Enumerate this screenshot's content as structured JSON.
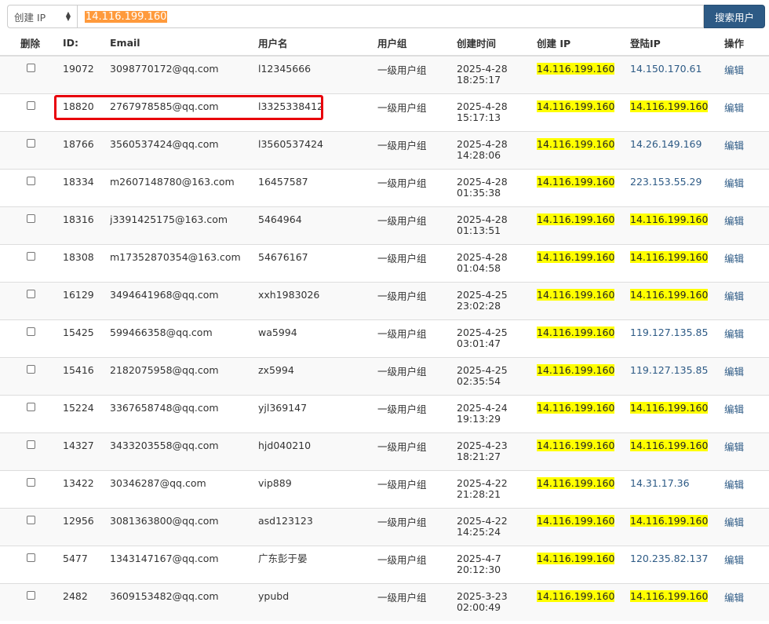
{
  "search": {
    "select_label": "创建 IP",
    "query": "14.116.199.160",
    "button_label": "搜索用户"
  },
  "table": {
    "headers": [
      "删除",
      "ID:",
      "Email",
      "用户名",
      "用户组",
      "创建时间",
      "创建 IP",
      "登陆IP",
      "操作"
    ],
    "rows": [
      {
        "id": "19072",
        "email": "3098770172@qq.com",
        "username": "l12345666",
        "group": "一级用户组",
        "date": "2025-4-28",
        "time": "18:25:17",
        "create_ip": "14.116.199.160",
        "login_ip": "14.150.170.61",
        "login_hl": false,
        "action": "编辑"
      },
      {
        "id": "18820",
        "email": "2767978585@qq.com",
        "username": "l3325338412",
        "group": "一级用户组",
        "date": "2025-4-28",
        "time": "15:17:13",
        "create_ip": "14.116.199.160",
        "login_ip": "14.116.199.160",
        "login_hl": true,
        "action": "编辑"
      },
      {
        "id": "18766",
        "email": "3560537424@qq.com",
        "username": "l3560537424",
        "group": "一级用户组",
        "date": "2025-4-28",
        "time": "14:28:06",
        "create_ip": "14.116.199.160",
        "login_ip": "14.26.149.169",
        "login_hl": false,
        "action": "编辑"
      },
      {
        "id": "18334",
        "email": "m2607148780@163.com",
        "username": "16457587",
        "group": "一级用户组",
        "date": "2025-4-28",
        "time": "01:35:38",
        "create_ip": "14.116.199.160",
        "login_ip": "223.153.55.29",
        "login_hl": false,
        "action": "编辑"
      },
      {
        "id": "18316",
        "email": "j3391425175@163.com",
        "username": "5464964",
        "group": "一级用户组",
        "date": "2025-4-28",
        "time": "01:13:51",
        "create_ip": "14.116.199.160",
        "login_ip": "14.116.199.160",
        "login_hl": true,
        "action": "编辑"
      },
      {
        "id": "18308",
        "email": "m17352870354@163.com",
        "username": "54676167",
        "group": "一级用户组",
        "date": "2025-4-28",
        "time": "01:04:58",
        "create_ip": "14.116.199.160",
        "login_ip": "14.116.199.160",
        "login_hl": true,
        "action": "编辑"
      },
      {
        "id": "16129",
        "email": "3494641968@qq.com",
        "username": "xxh1983026",
        "group": "一级用户组",
        "date": "2025-4-25",
        "time": "23:02:28",
        "create_ip": "14.116.199.160",
        "login_ip": "14.116.199.160",
        "login_hl": true,
        "action": "编辑"
      },
      {
        "id": "15425",
        "email": "599466358@qq.com",
        "username": "wa5994",
        "group": "一级用户组",
        "date": "2025-4-25",
        "time": "03:01:47",
        "create_ip": "14.116.199.160",
        "login_ip": "119.127.135.85",
        "login_hl": false,
        "action": "编辑"
      },
      {
        "id": "15416",
        "email": "2182075958@qq.com",
        "username": "zx5994",
        "group": "一级用户组",
        "date": "2025-4-25",
        "time": "02:35:54",
        "create_ip": "14.116.199.160",
        "login_ip": "119.127.135.85",
        "login_hl": false,
        "action": "编辑"
      },
      {
        "id": "15224",
        "email": "3367658748@qq.com",
        "username": "yjl369147",
        "group": "一级用户组",
        "date": "2025-4-24",
        "time": "19:13:29",
        "create_ip": "14.116.199.160",
        "login_ip": "14.116.199.160",
        "login_hl": true,
        "action": "编辑"
      },
      {
        "id": "14327",
        "email": "3433203558@qq.com",
        "username": "hjd040210",
        "group": "一级用户组",
        "date": "2025-4-23",
        "time": "18:21:27",
        "create_ip": "14.116.199.160",
        "login_ip": "14.116.199.160",
        "login_hl": true,
        "action": "编辑"
      },
      {
        "id": "13422",
        "email": "30346287@qq.com",
        "username": "vip889",
        "group": "一级用户组",
        "date": "2025-4-22",
        "time": "21:28:21",
        "create_ip": "14.116.199.160",
        "login_ip": "14.31.17.36",
        "login_hl": false,
        "action": "编辑"
      },
      {
        "id": "12956",
        "email": "3081363800@qq.com",
        "username": "asd123123",
        "group": "一级用户组",
        "date": "2025-4-22",
        "time": "14:25:24",
        "create_ip": "14.116.199.160",
        "login_ip": "14.116.199.160",
        "login_hl": true,
        "action": "编辑"
      },
      {
        "id": "5477",
        "email": "1343147167@qq.com",
        "username": "广东彭于晏",
        "group": "一级用户组",
        "date": "2025-4-7",
        "time": "20:12:30",
        "create_ip": "14.116.199.160",
        "login_ip": "120.235.82.137",
        "login_hl": false,
        "action": "编辑"
      },
      {
        "id": "2482",
        "email": "3609153482@qq.com",
        "username": "ypubd",
        "group": "一级用户组",
        "date": "2025-3-23",
        "time": "02:00:49",
        "create_ip": "14.116.199.160",
        "login_ip": "14.116.199.160",
        "login_hl": true,
        "action": "编辑"
      }
    ]
  },
  "colors": {
    "highlight": "#ffff00",
    "search_highlight": "#ff9a3c",
    "button": "#2d5a85",
    "annotation_box": "#e8000b"
  }
}
